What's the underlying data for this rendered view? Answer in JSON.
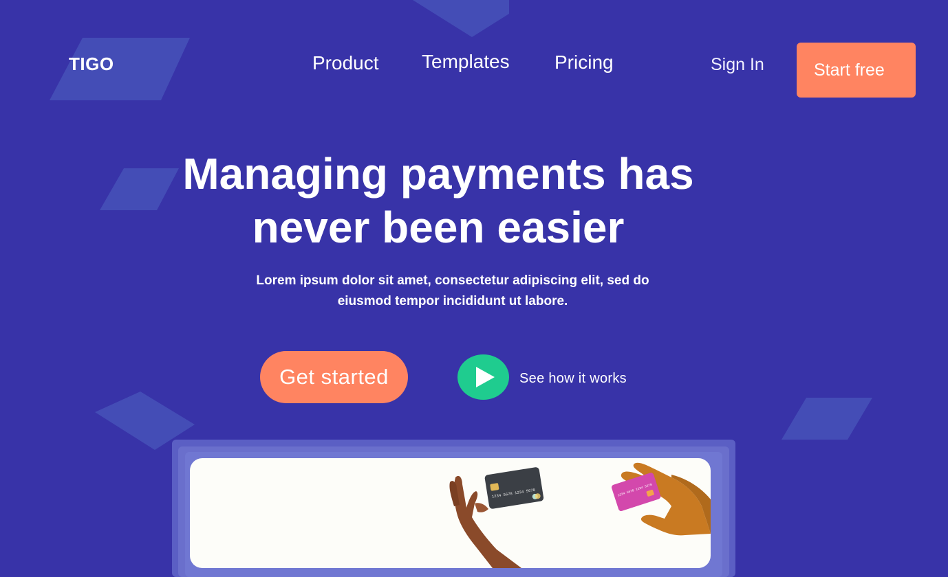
{
  "brand": {
    "logo": "TIGO"
  },
  "nav": {
    "items": [
      {
        "label": "Product"
      },
      {
        "label": "Templates"
      },
      {
        "label": "Pricing"
      }
    ],
    "sign_in": "Sign In",
    "start_free": "Start free"
  },
  "hero": {
    "title_line1": "Managing payments has",
    "title_line2": "never been easier",
    "subtitle_line1": "Lorem ipsum dolor sit amet, consectetur adipiscing elit, sed do",
    "subtitle_line2": "eiusmod tempor incididunt ut labore.",
    "cta_primary": "Get started",
    "cta_video": "See how it works"
  },
  "cards": {
    "dark_card_number": "1234 5678 1234 5678",
    "pink_card_number": "1234 5678 1234 5678"
  },
  "colors": {
    "background": "#3833a8",
    "accent": "#ff8461",
    "play": "#1fcc8f",
    "deco_shape": "#4652b8"
  },
  "icons": {
    "play": "play-icon",
    "card_chip": "card-chip-icon",
    "card_network": "card-network-icon"
  }
}
